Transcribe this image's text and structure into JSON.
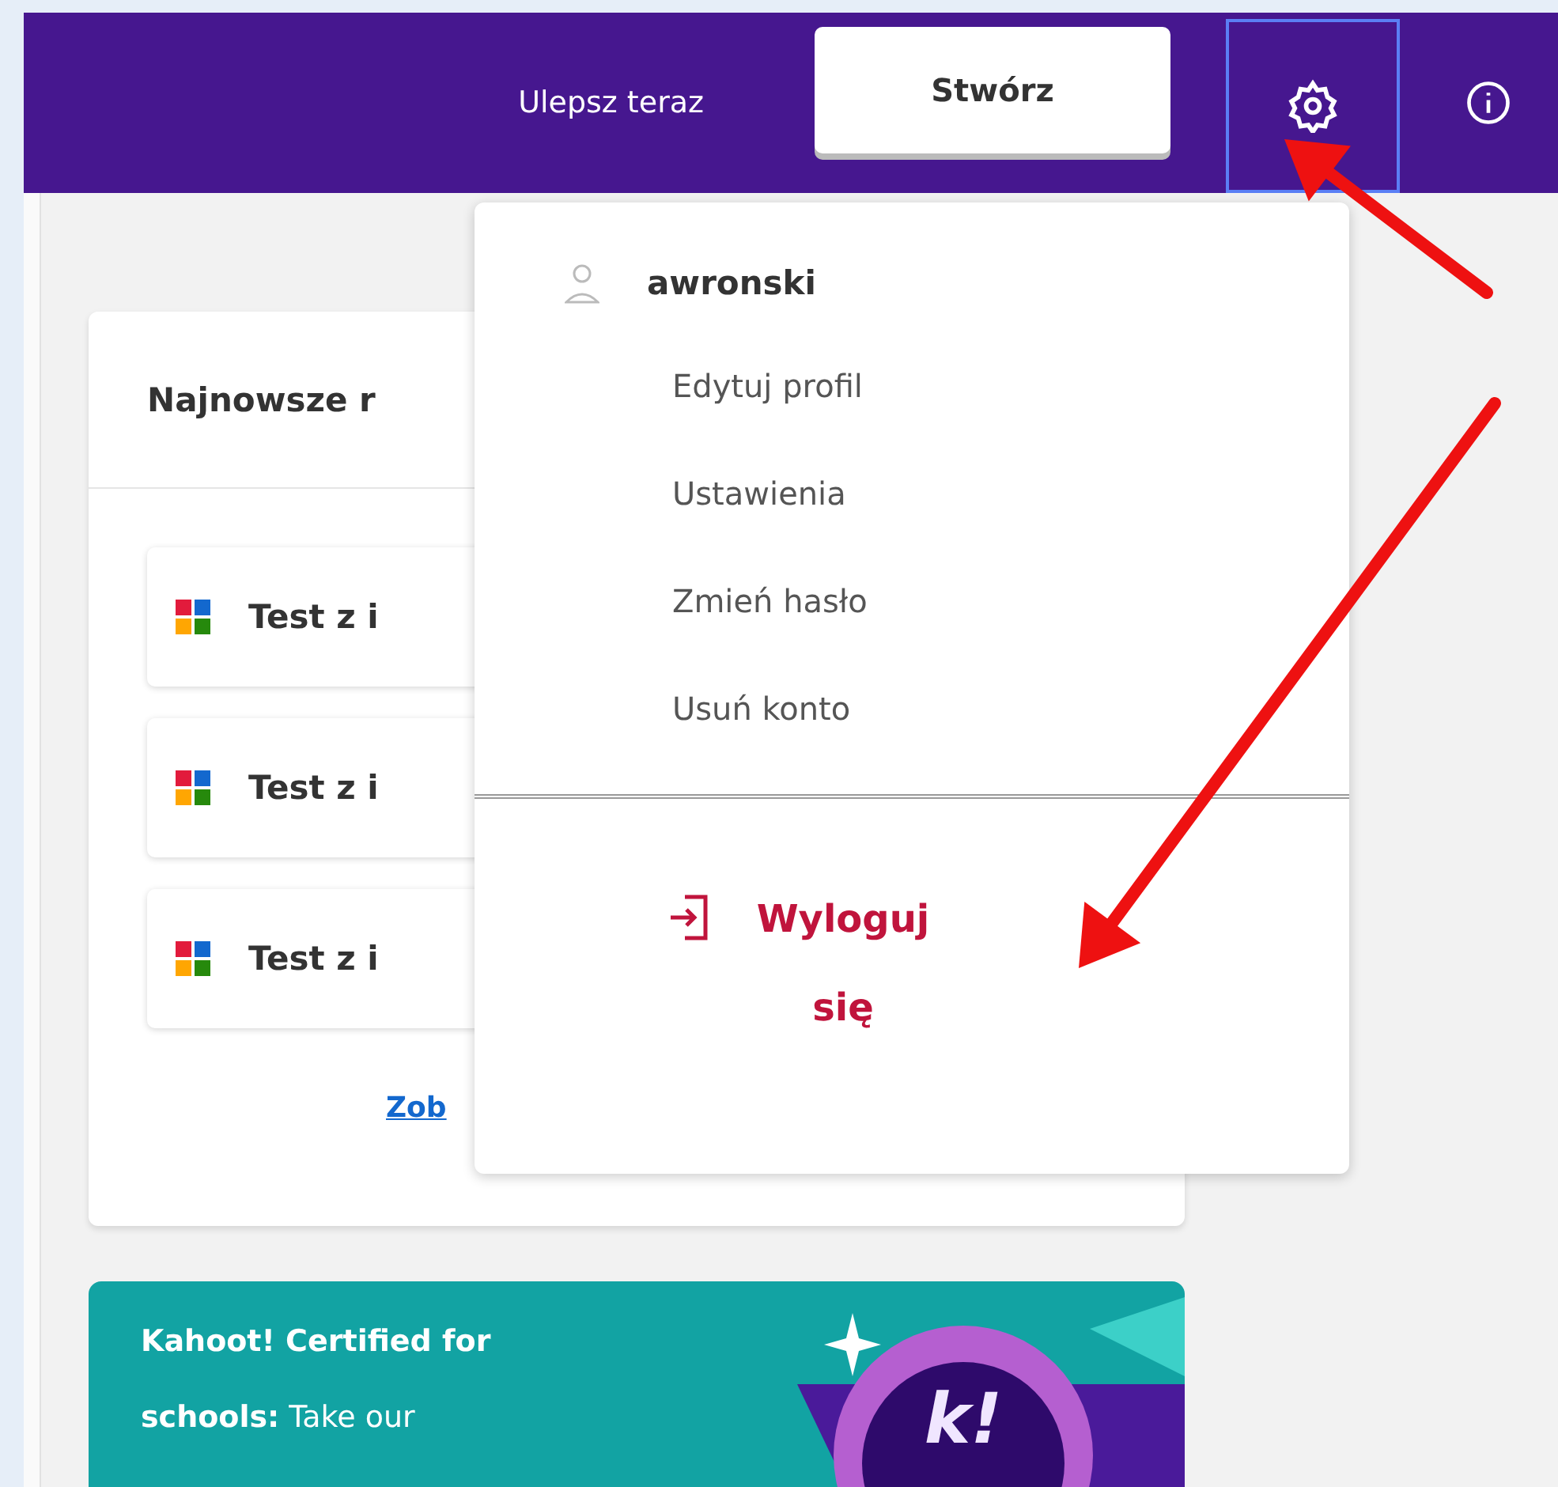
{
  "top_bar": {
    "upgrade_link": "Ulepsz teraz",
    "create_button": "Stwórz",
    "settings_selected": true
  },
  "recent_card": {
    "title": "Najnowsze r",
    "items": [
      {
        "title": "Test z i"
      },
      {
        "title": "Test z i"
      },
      {
        "title": "Test z i"
      }
    ],
    "see_all_link": "Zob"
  },
  "promo_card": {
    "text": "**Kahoot! Certified for schools:** Take our",
    "badge_text": "k!"
  },
  "settings_menu": {
    "username": "awronski",
    "items": [
      {
        "label": "Edytuj profil"
      },
      {
        "label": "Ustawienia"
      },
      {
        "label": "Zmień hasło"
      },
      {
        "label": "Usuń konto"
      }
    ],
    "logout": "Wyloguj się"
  },
  "annotations": [
    {
      "kind": "arrow"
    },
    {
      "kind": "arrow"
    }
  ]
}
